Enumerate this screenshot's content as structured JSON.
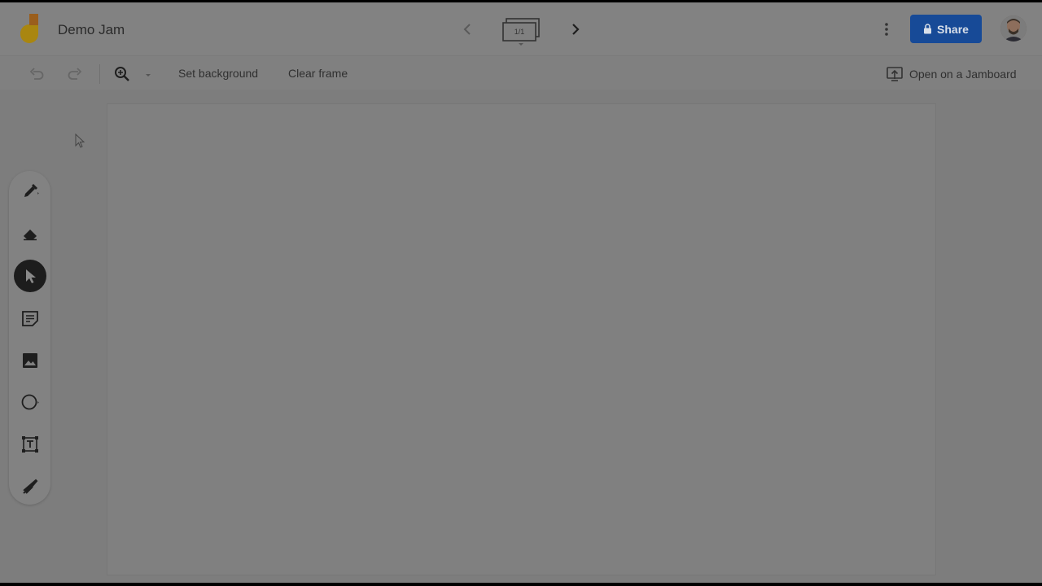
{
  "header": {
    "title": "Demo Jam",
    "frame_count": "1/1",
    "share_label": "Share"
  },
  "toolbar": {
    "set_background_label": "Set background",
    "clear_frame_label": "Clear frame",
    "open_jamboard_label": "Open on a Jamboard"
  },
  "tools": [
    {
      "name": "pen-tool",
      "icon": "pen-icon"
    },
    {
      "name": "eraser-tool",
      "icon": "eraser-icon"
    },
    {
      "name": "select-tool",
      "icon": "cursor-arrow-icon",
      "active": true
    },
    {
      "name": "sticky-note-tool",
      "icon": "sticky-note-icon"
    },
    {
      "name": "add-image-tool",
      "icon": "image-icon"
    },
    {
      "name": "circle-tool",
      "icon": "circle-icon"
    },
    {
      "name": "text-box-tool",
      "icon": "text-box-icon"
    },
    {
      "name": "laser-tool",
      "icon": "laser-icon"
    }
  ],
  "colors": {
    "share_button": "#174a97",
    "dim_overlay_bg": "#808080"
  }
}
